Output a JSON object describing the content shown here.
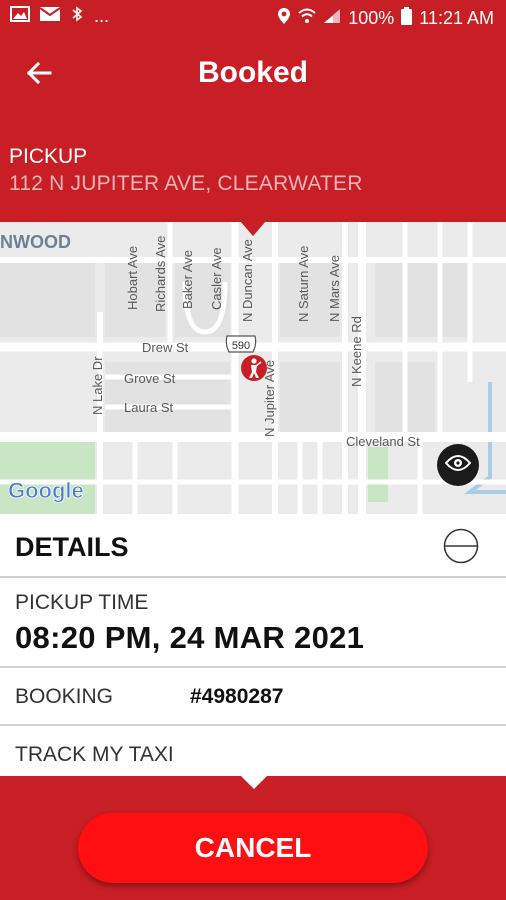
{
  "status_bar": {
    "left_icons": [
      "image-icon",
      "mail-icon",
      "bluetooth-icon"
    ],
    "more": "...",
    "right_icons": [
      "location-icon",
      "wifi-icon",
      "signal-icon",
      "battery-icon"
    ],
    "battery": "100%",
    "time": "11:21 AM"
  },
  "app_bar": {
    "back_icon": "arrow-left-icon",
    "title": "Booked"
  },
  "pickup": {
    "label": "PICKUP",
    "address": "112 N JUPITER AVE, CLEARWATER"
  },
  "map": {
    "labels": {
      "neighborhood": "NWOOD",
      "hobart": "Hobart Ave",
      "richards": "Richards Ave",
      "baker": "Baker Ave",
      "casler": "Casler Ave",
      "duncan": "N Duncan Ave",
      "saturn": "N Saturn Ave",
      "mars": "N Mars Ave",
      "keene": "N Keene Rd",
      "drew": "Drew St",
      "grove": "Grove St",
      "laura": "Laura St",
      "lake": "N Lake Dr",
      "jupiter": "N Jupiter Ave",
      "cleveland": "Cleveland St",
      "route": "590",
      "google": "Google"
    },
    "eye_icon": "eye-icon"
  },
  "details": {
    "title": "DETAILS",
    "collapse_icon": "minus-circle-icon",
    "pickup_time_label": "PICKUP TIME",
    "pickup_time_value": "08:20 PM, 24 MAR 2021",
    "booking_label": "BOOKING",
    "booking_value": "#4980287",
    "track_label": "TRACK MY TAXI"
  },
  "footer": {
    "cancel_label": "CANCEL"
  },
  "colors": {
    "brand_red": "#c81e25",
    "cancel_red": "#ff0f12",
    "address_text": "#f0b4b6"
  }
}
